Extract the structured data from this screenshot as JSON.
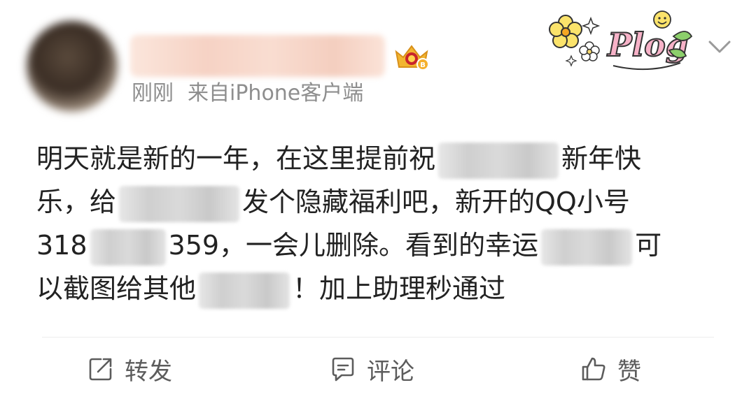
{
  "post": {
    "time": "刚刚",
    "source": "来自iPhone客户端",
    "lines": {
      "l1a": "明天就是新的一年，在这里提前祝",
      "l1b": "新年快",
      "l2a": "乐，给",
      "l2b": "发个隐藏福利吧，新开的QQ小号",
      "l3a": "318",
      "l3b": "359，一会儿删除。看到的幸运",
      "l3c": "可",
      "l4a": "以截图给其他",
      "l4b": "！加上助理秒通过"
    },
    "sticker_text": "Plog"
  },
  "actions": {
    "repost": "转发",
    "comment": "评论",
    "like": "赞"
  },
  "icons": {
    "badge": "crown-badge-icon",
    "chevron": "chevron-down-icon",
    "repost": "share-icon",
    "comment": "comment-icon",
    "like": "thumbs-up-icon",
    "sticker": "flower-plog-sticker-icon"
  },
  "colors": {
    "text": "#222222",
    "meta": "#8e8e8e",
    "action": "#5c5c5c",
    "badge_gold": "#f2b530"
  }
}
